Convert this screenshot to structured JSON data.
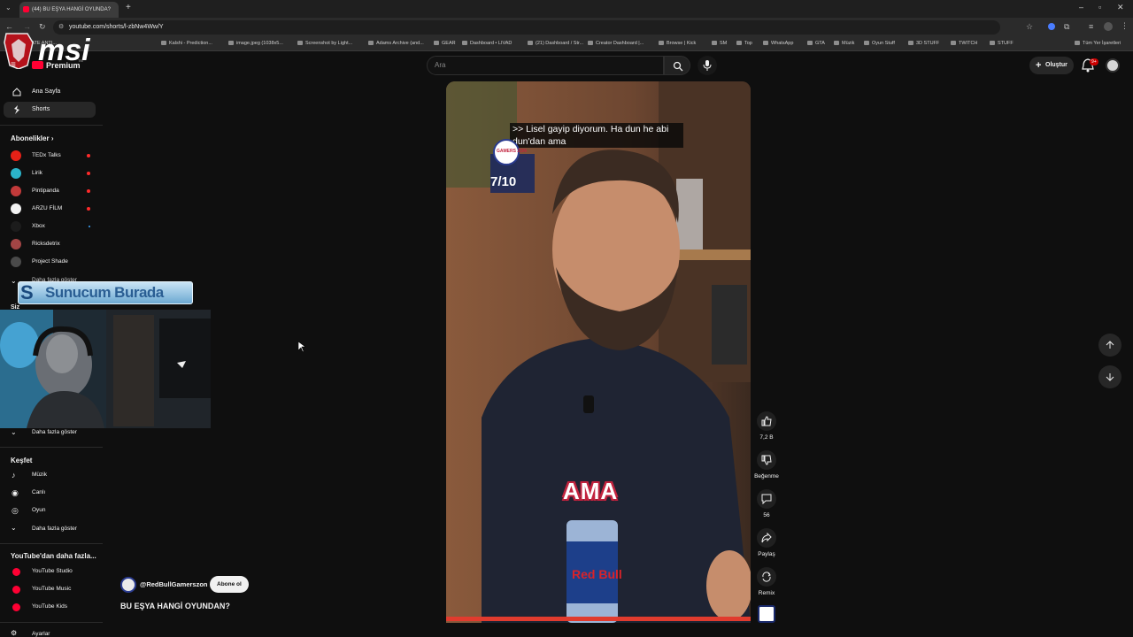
{
  "browser": {
    "tab_title": "(44) BU EŞYA HANGİ OYUNDA?",
    "url": "youtube.com/shorts/l-zbNw4Ww/Y",
    "bookmarks": [
      "GATE ANTI...",
      "Kalshi - Prediction...",
      "image.jpeg (1038x5...",
      "Screenshot by Light...",
      "Adams Archive (and...",
      "GEAR",
      "Dashboard • LIVAD",
      "(21) Dashboard / Str...",
      "Creator Dashboard |...",
      "Browse | Kick",
      "SM",
      "Top",
      "WhatsApp",
      "GTA",
      "Müzik",
      "Oyun Stuff",
      "3D STUFF",
      "TWITCH",
      "STUFF"
    ],
    "all_bookmarks": "Tüm Yer İşaretleri"
  },
  "header": {
    "premium": "Premium",
    "tm": "TM",
    "search_placeholder": "Ara",
    "create_label": "Oluştur",
    "notif_count": "9+"
  },
  "sidebar": {
    "home": "Ana Sayfa",
    "shorts": "Shorts",
    "subs_heading": "Abonelikler",
    "subscriptions": [
      {
        "name": "TEDx Talks",
        "color": "#e62117"
      },
      {
        "name": "Lirik",
        "color": "#2bb3c9"
      },
      {
        "name": "Pintipanda",
        "color": "#c23a3a"
      },
      {
        "name": "ARZU FİLM",
        "color": "#f2f2f2"
      },
      {
        "name": "Xbox",
        "color": "#1c1c1c"
      },
      {
        "name": "Ricksdetrix",
        "color": "#a24545"
      },
      {
        "name": "Project Shade",
        "color": "#4a4a4a"
      }
    ],
    "show_more_partial": "Daha fazla göster",
    "you_partial": "Siz",
    "show_more": "Daha fazla göster",
    "explore_heading": "Keşfet",
    "explore": [
      "Müzik",
      "Canlı",
      "Oyun"
    ],
    "explore_more": "Daha fazla göster",
    "more_heading": "YouTube'dan daha fazla...",
    "more": [
      "YouTube Studio",
      "YouTube Music",
      "YouTube Kids"
    ],
    "settings_partial": "Ayarlar"
  },
  "overlay": {
    "logo": "msi",
    "banner": "Sunucum Burada",
    "banner_letter": "S"
  },
  "video": {
    "caption": ">> Lisel gayip diyorum. Ha dun he abi dun'dan ama",
    "score_brand": "GAMERS ZON",
    "score": "7/10",
    "subtitle_word": "AMA"
  },
  "actions": {
    "likes": "7,2 B",
    "dislike": "Beğenme",
    "comments": "56",
    "share": "Paylaş",
    "remix": "Remix"
  },
  "meta": {
    "channel": "@RedBullGamerszon",
    "subscribe": "Abone ol",
    "title": "BU EŞYA HANGİ OYUNDAN?"
  }
}
